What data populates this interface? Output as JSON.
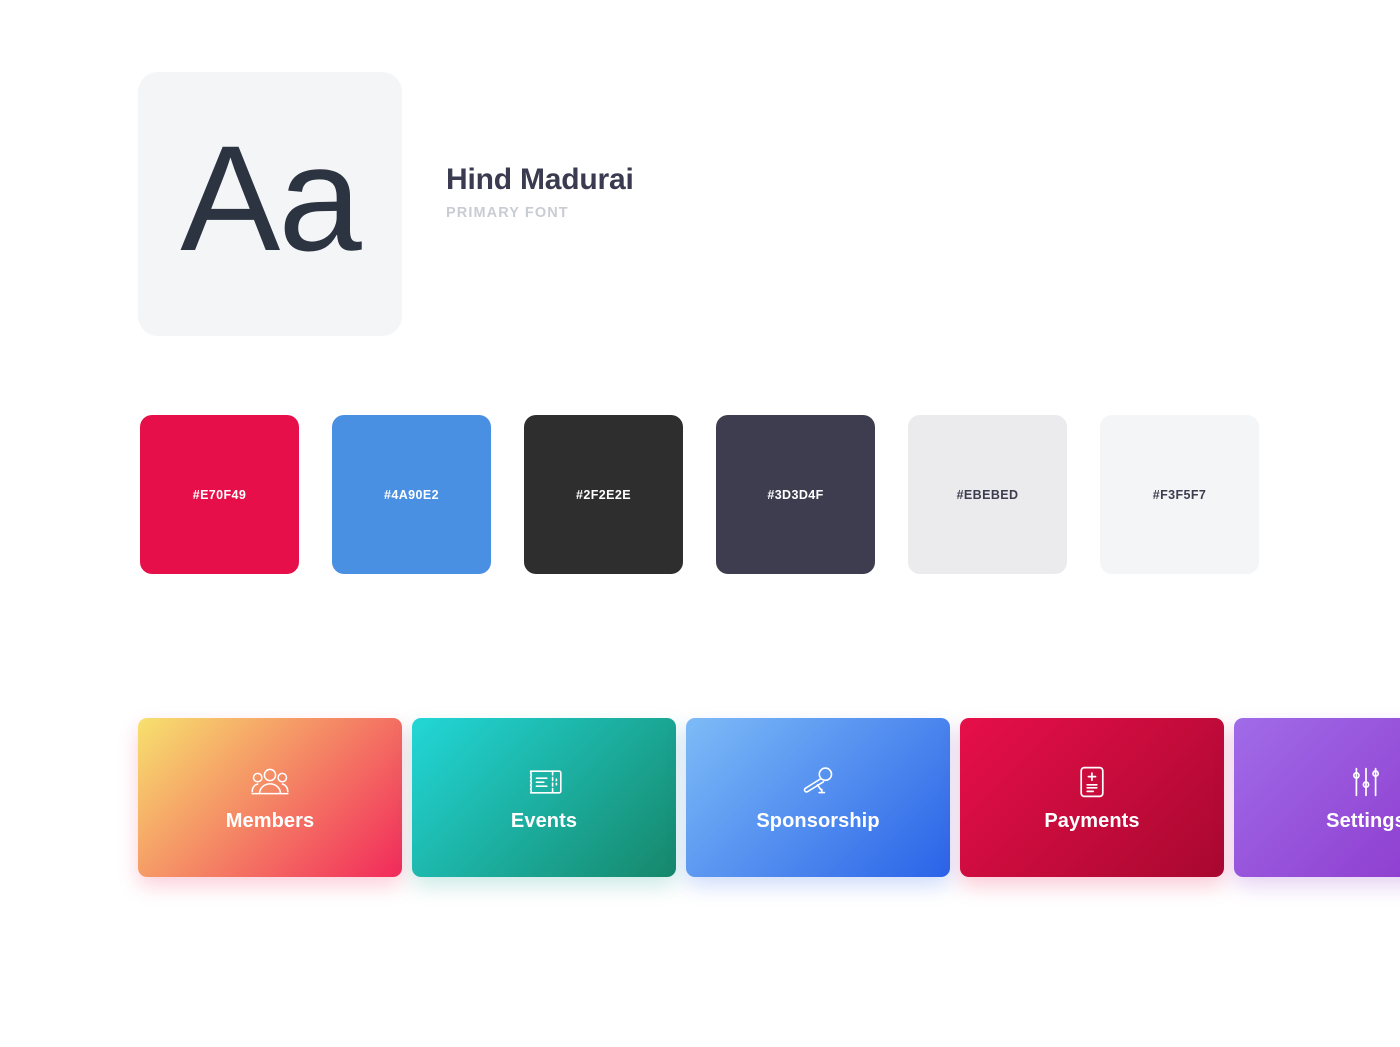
{
  "typography": {
    "sample_glyph": "Aa",
    "font_name": "Hind Madurai",
    "role_label": "PRIMARY FONT",
    "tile_background": "#F3F5F7",
    "glyph_color": "#2C3442",
    "name_color": "#3A3A50",
    "role_color": "#C9CCD2"
  },
  "palette": {
    "swatches": [
      {
        "hex": "#E70F49",
        "label": "#E70F49",
        "text_color": "#FFFFFF"
      },
      {
        "hex": "#4A90E2",
        "label": "#4A90E2",
        "text_color": "#FFFFFF"
      },
      {
        "hex": "#2F2E2E",
        "label": "#2F2E2E",
        "text_color": "#FFFFFF"
      },
      {
        "hex": "#3D3D4F",
        "label": "#3D3D4F",
        "text_color": "#FFFFFF"
      },
      {
        "hex": "#EBEBED",
        "label": "#EBEBED",
        "text_color": "#3D3D4F"
      },
      {
        "hex": "#F3F5F7",
        "label": "#F3F5F7",
        "text_color": "#3D3D4F"
      }
    ]
  },
  "nav_cards": {
    "items": [
      {
        "label": "Members",
        "icon": "group-people-icon",
        "gradient_from": "#F7E16E",
        "gradient_to": "#F2295B",
        "shadow_color": "rgba(242, 41, 91, 0.22)"
      },
      {
        "label": "Events",
        "icon": "ticket-icon",
        "gradient_from": "#22D7D7",
        "gradient_to": "#16876A",
        "shadow_color": "rgba(22, 160, 140, 0.22)"
      },
      {
        "label": "Sponsorship",
        "icon": "microphone-icon",
        "gradient_from": "#7DBBF7",
        "gradient_to": "#2A63E8",
        "shadow_color": "rgba(42, 99, 232, 0.22)"
      },
      {
        "label": "Payments",
        "icon": "invoice-icon",
        "gradient_from": "#E70F49",
        "gradient_to": "#A8082F",
        "shadow_color": "rgba(231, 15, 73, 0.22)"
      },
      {
        "label": "Settings",
        "icon": "sliders-icon",
        "gradient_from": "#A06BE8",
        "gradient_to": "#8B33C9",
        "shadow_color": "rgba(139, 51, 201, 0.22)"
      }
    ]
  }
}
